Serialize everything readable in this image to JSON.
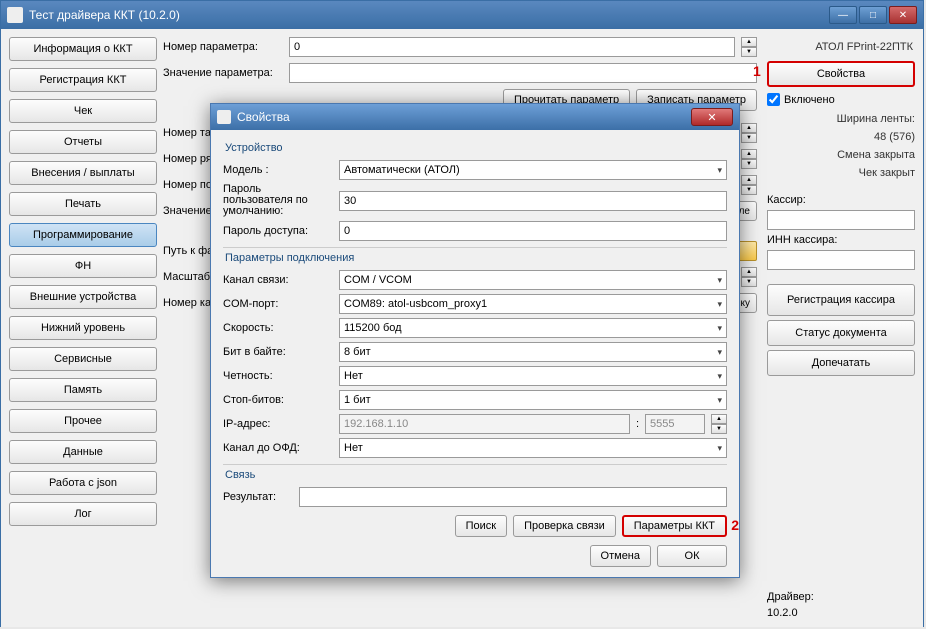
{
  "window": {
    "title": "Тест драйвера ККТ (10.2.0)"
  },
  "sidebar": {
    "items": [
      "Информация о ККТ",
      "Регистрация ККТ",
      "Чек",
      "Отчеты",
      "Внесения / выплаты",
      "Печать",
      "Программирование",
      "ФН",
      "Внешние устройства",
      "Нижний уровень",
      "Сервисные",
      "Память",
      "Прочее",
      "Данные",
      "Работа с json",
      "Лог"
    ],
    "active_index": 6
  },
  "center": {
    "param_number_label": "Номер параметра:",
    "param_number_value": "0",
    "param_value_label": "Значение параметра:",
    "param_value_value": "",
    "read_param_btn": "Прочитать параметр",
    "write_param_btn": "Записать параметр",
    "table_number_label": "Номер таблицы",
    "row_number_label": "Номер ряда:",
    "field_number_label": "Номер поля:",
    "field_value_label": "Значение поля",
    "field_end_btn": "ь поле",
    "file_path_label": "Путь к файлу",
    "scale_label": "Масштаб, %:",
    "pic_number_label": "Номер картинки",
    "pic_end_btn": "ртинку"
  },
  "right": {
    "device_name": "АТОЛ FPrint-22ПТК",
    "properties_btn": "Свойства",
    "annot1": "1",
    "enabled_label": "Включено",
    "tape_width_label": "Ширина ленты:",
    "tape_width_value": "48 (576)",
    "shift_closed": "Смена закрыта",
    "check_closed": "Чек закрыт",
    "cashier_label": "Кассир:",
    "inn_label": "ИНН кассира:",
    "reg_cashier_btn": "Регистрация кассира",
    "doc_status_btn": "Статус документа",
    "reprint_btn": "Допечатать",
    "driver_label": "Драйвер:",
    "driver_ver": "10.2.0"
  },
  "dialog": {
    "title": "Свойства",
    "group_device": "Устройство",
    "model_label": "Модель :",
    "model_value": "Автоматически (АТОЛ)",
    "user_pwd_label": "Пароль пользователя по умолчанию:",
    "user_pwd_value": "30",
    "access_pwd_label": "Пароль доступа:",
    "access_pwd_value": "0",
    "group_conn": "Параметры подключения",
    "channel_label": "Канал связи:",
    "channel_value": "COM / VCOM",
    "com_label": "COM-порт:",
    "com_value": "COM89: atol-usbcom_proxy1",
    "speed_label": "Скорость:",
    "speed_value": "115200 бод",
    "bits_label": "Бит в байте:",
    "bits_value": "8 бит",
    "parity_label": "Четность:",
    "parity_value": "Нет",
    "stop_label": "Стоп-битов:",
    "stop_value": "1 бит",
    "ip_label": "IP-адрес:",
    "ip_placeholder": "192.168.1.10",
    "port_value": "5555",
    "ofd_label": "Канал до ОФД:",
    "ofd_value": "Нет",
    "group_link": "Связь",
    "result_label": "Результат:",
    "search_btn": "Поиск",
    "check_btn": "Проверка связи",
    "kkt_params_btn": "Параметры ККТ",
    "annot2": "2",
    "cancel_btn": "Отмена",
    "ok_btn": "ОК"
  }
}
